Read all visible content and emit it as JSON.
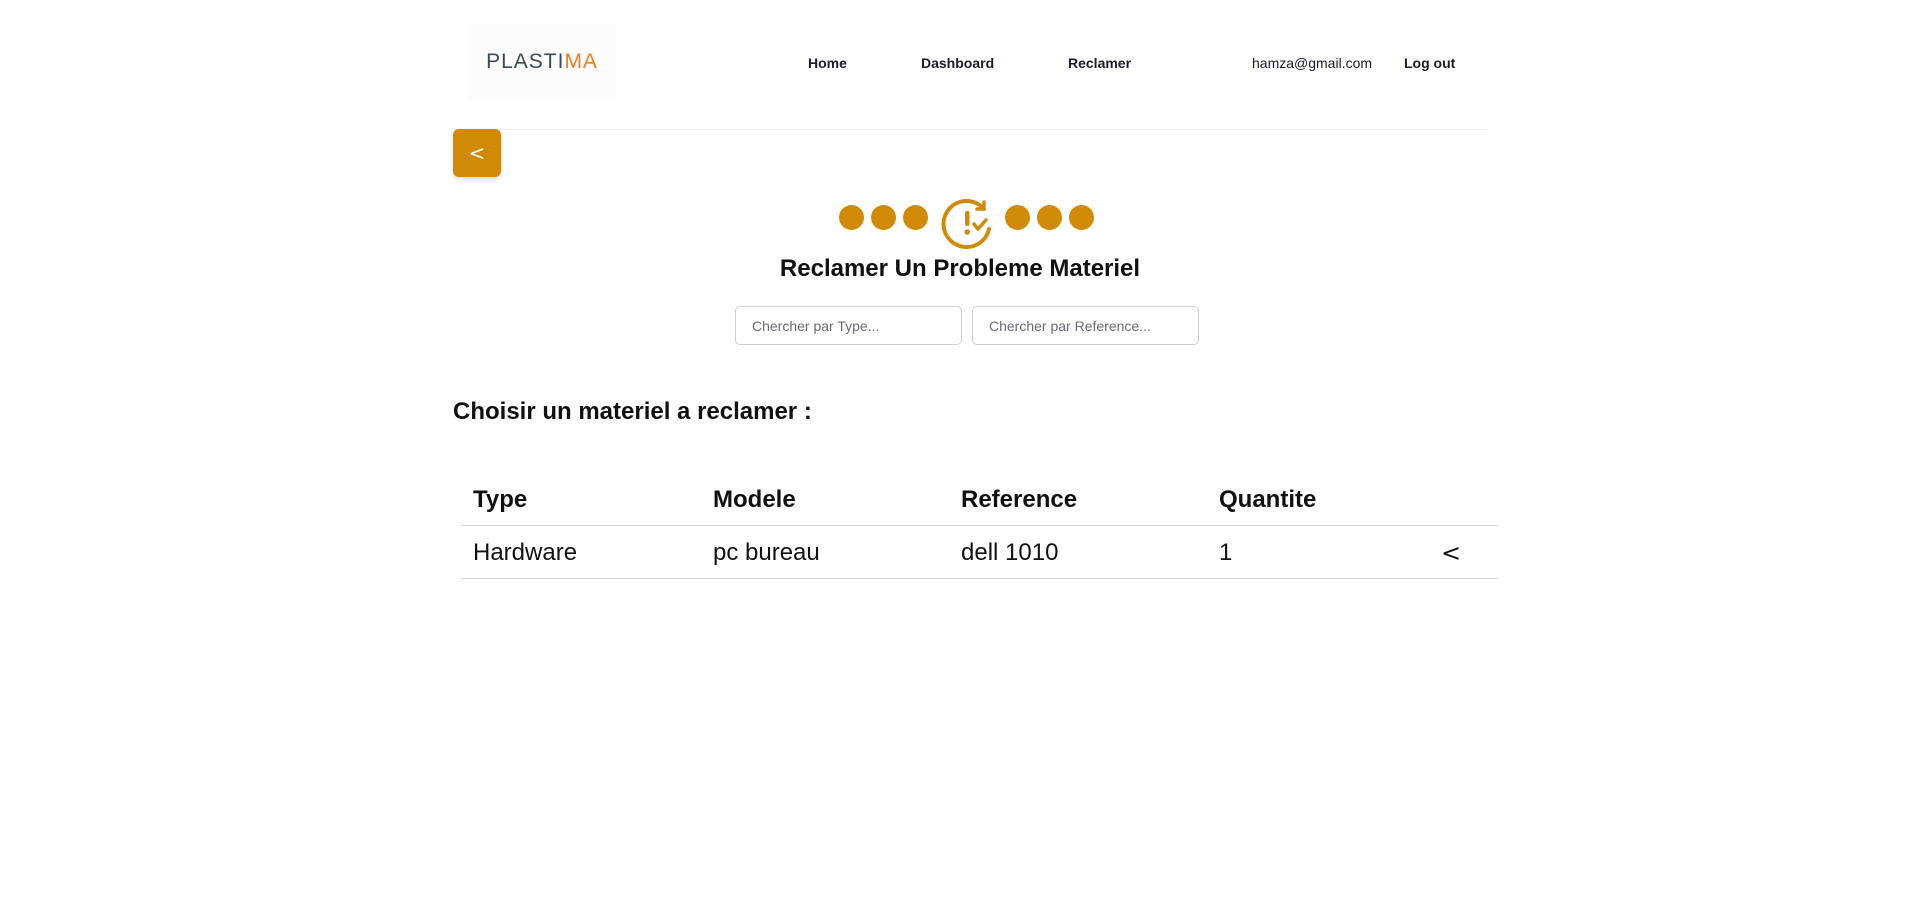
{
  "header": {
    "logo": {
      "part1": "PLASTI",
      "part2": "MA"
    },
    "nav": {
      "home": "Home",
      "dashboard": "Dashboard",
      "reclamer": "Reclamer"
    },
    "user_email": "hamza@gmail.com",
    "logout": "Log out"
  },
  "back_button": {
    "label": "<"
  },
  "stepper": {
    "dots_before": 3,
    "dots_after": 3,
    "icon": "alert-check-circle-icon"
  },
  "title": "Reclamer Un Probleme Materiel",
  "search": {
    "type_placeholder": "Chercher par Type...",
    "type_value": "",
    "reference_placeholder": "Chercher par Reference...",
    "reference_value": ""
  },
  "section_title": "Choisir un materiel a reclamer :",
  "table": {
    "columns": [
      "Type",
      "Modele",
      "Reference",
      "Quantite"
    ],
    "rows": [
      {
        "type": "Hardware",
        "modele": "pc bureau",
        "reference": "dell 1010",
        "quantite": "1",
        "action": "<"
      }
    ]
  },
  "colors": {
    "accent": "#d08a06",
    "logo_dark": "#3c4a57",
    "logo_orange": "#f07f1e"
  }
}
